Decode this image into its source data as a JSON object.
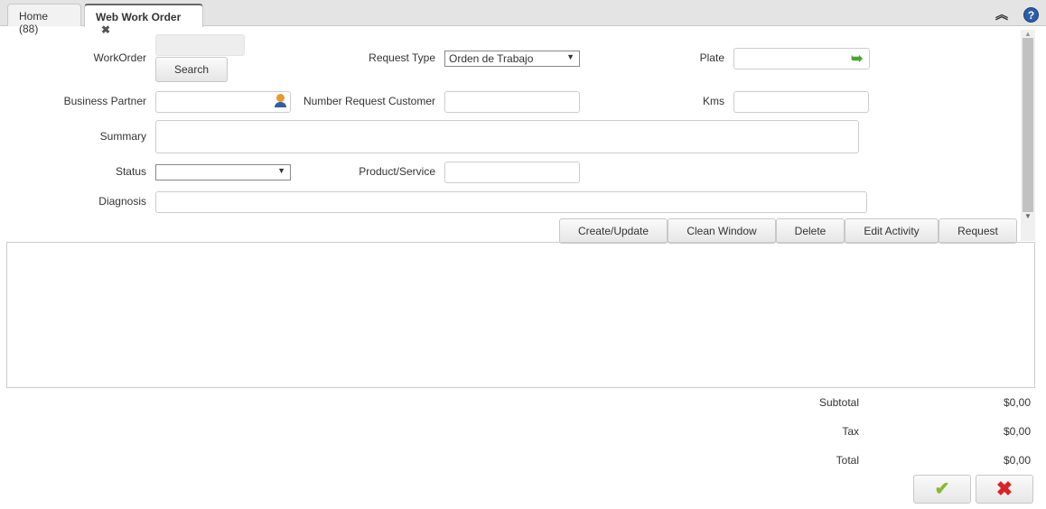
{
  "tabs": [
    {
      "label": "Home (88)"
    },
    {
      "label": "Web Work Order",
      "close": "✖"
    }
  ],
  "header_icons": [
    "collapse-icon",
    "help-icon"
  ],
  "form": {
    "workorder_label": "WorkOrder",
    "workorder_value": "",
    "search_label": "Search",
    "request_type_label": "Request Type",
    "request_type_value": "Orden de Trabajo",
    "plate_label": "Plate",
    "plate_value": "",
    "business_partner_label": "Business Partner",
    "business_partner_value": "",
    "number_request_label": "Number Request Customer",
    "number_request_value": "",
    "kms_label": "Kms",
    "kms_value": "",
    "summary_label": "Summary",
    "summary_value": "",
    "status_label": "Status",
    "status_value": "",
    "product_label": "Product/Service",
    "product_value": "",
    "diagnosis_label": "Diagnosis",
    "diagnosis_value": ""
  },
  "actions": [
    "Create/Update",
    "Clean Window",
    "Delete",
    "Edit Activity",
    "Request"
  ],
  "totals": {
    "subtotal_label": "Subtotal",
    "subtotal": "$0,00",
    "tax_label": "Tax",
    "tax": "$0,00",
    "total_label": "Total",
    "total": "$0,00"
  },
  "colors": {
    "ok": "#8ab833",
    "cancel": "#d9232a",
    "help": "#2a5ea8"
  }
}
